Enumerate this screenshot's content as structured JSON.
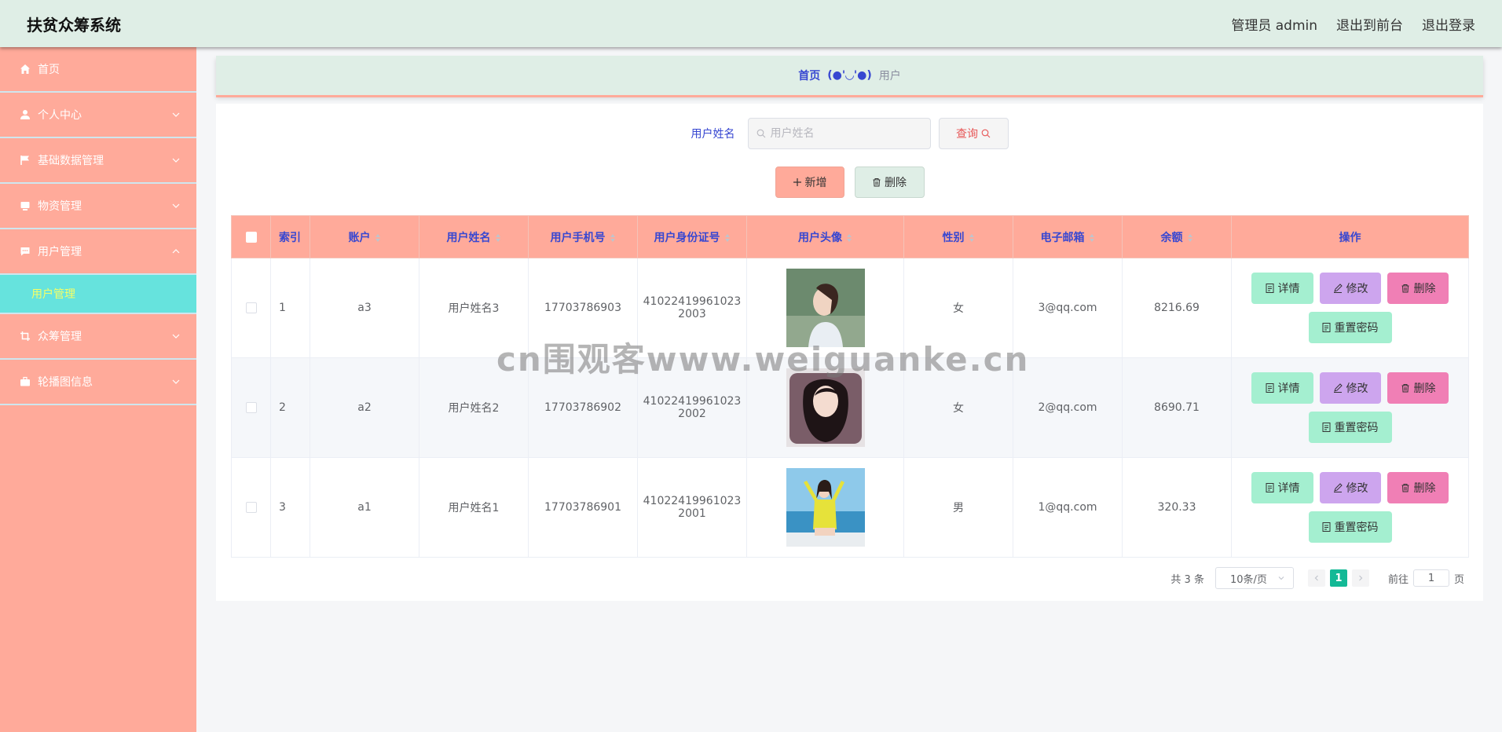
{
  "header": {
    "app_title": "扶贫众筹系统",
    "admin_label": "管理员 admin",
    "to_front": "退出到前台",
    "logout": "退出登录"
  },
  "sidebar": {
    "items": [
      {
        "label": "首页",
        "icon": "home-icon"
      },
      {
        "label": "个人中心",
        "icon": "user-icon"
      },
      {
        "label": "基础数据管理",
        "icon": "flag-icon"
      },
      {
        "label": "物资管理",
        "icon": "box-icon"
      },
      {
        "label": "用户管理",
        "icon": "chat-icon"
      },
      {
        "label": "众筹管理",
        "icon": "crop-icon"
      },
      {
        "label": "轮播图信息",
        "icon": "briefcase-icon"
      }
    ],
    "sub_active": "用户管理"
  },
  "breadcrumb": {
    "home": "首页",
    "separator": "(●'◡'●)",
    "current": "用户"
  },
  "search": {
    "label": "用户姓名",
    "placeholder": "用户姓名",
    "query_label": "查询"
  },
  "actions": {
    "add_label": "新增",
    "delete_label": "删除"
  },
  "table": {
    "headers": {
      "index": "索引",
      "account": "账户",
      "name": "用户姓名",
      "phone": "用户手机号",
      "id_card": "用户身份证号",
      "avatar": "用户头像",
      "gender": "性别",
      "email": "电子邮箱",
      "balance": "余额",
      "ops": "操作"
    },
    "rows": [
      {
        "index": "1",
        "account": "a3",
        "name": "用户姓名3",
        "phone": "17703786903",
        "id_line1": "41022419961023",
        "id_line2": "2003",
        "gender": "女",
        "email": "3@qq.com",
        "balance": "8216.69"
      },
      {
        "index": "2",
        "account": "a2",
        "name": "用户姓名2",
        "phone": "17703786902",
        "id_line1": "41022419961023",
        "id_line2": "2002",
        "gender": "女",
        "email": "2@qq.com",
        "balance": "8690.71"
      },
      {
        "index": "3",
        "account": "a1",
        "name": "用户姓名1",
        "phone": "17703786901",
        "id_line1": "41022419961023",
        "id_line2": "2001",
        "gender": "男",
        "email": "1@qq.com",
        "balance": "320.33"
      }
    ],
    "op_labels": {
      "detail": "详情",
      "edit": "修改",
      "delete": "删除",
      "reset": "重置密码"
    }
  },
  "pagination": {
    "total": "共 3 条",
    "page_size": "10条/页",
    "current_page": "1",
    "goto_label": "前往",
    "goto_value": "1",
    "page_suffix": "页"
  },
  "watermark": "cn围观客www.weiguanke.cn",
  "colors": {
    "sidebar_bg": "#ffaa9a",
    "header_bg": "#dfeee6",
    "submenu_active_bg": "#66e3dd",
    "header_text": "#3747d1",
    "pagination_active": "#13b996"
  }
}
